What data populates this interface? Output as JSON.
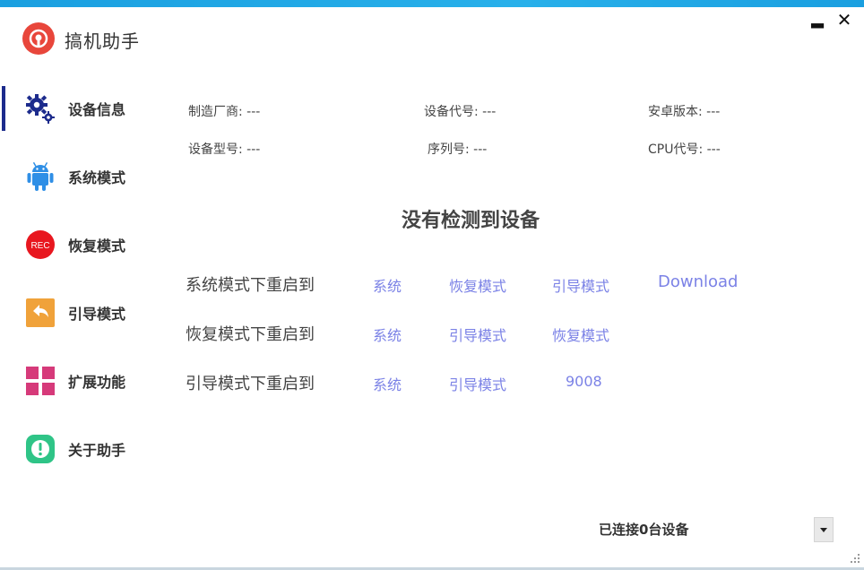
{
  "app": {
    "title": "搞机助手"
  },
  "window_controls": {
    "minimize": "▂",
    "close": "✕"
  },
  "sidebar": {
    "items": [
      {
        "label": "设备信息",
        "icon": "gears-icon",
        "active": true
      },
      {
        "label": "系统模式",
        "icon": "android-icon"
      },
      {
        "label": "恢复模式",
        "icon": "rec-icon",
        "icon_text": "REC"
      },
      {
        "label": "引导模式",
        "icon": "back-arrow-icon"
      },
      {
        "label": "扩展功能",
        "icon": "grid-icon"
      },
      {
        "label": "关于助手",
        "icon": "info-alert-icon"
      }
    ]
  },
  "device_info": {
    "manufacturer": "制造厂商: ---",
    "device_code": "设备代号: ---",
    "android_version": "安卓版本: ---",
    "model": "设备型号: ---",
    "serial": "序列号: ---",
    "cpu_code": "CPU代号: ---"
  },
  "detect_message": "没有检测到设备",
  "reboot_rows": [
    {
      "label": "系统模式下重启到",
      "options": [
        "系统",
        "恢复模式",
        "引导模式",
        "Download"
      ]
    },
    {
      "label": "恢复模式下重启到",
      "options": [
        "系统",
        "引导模式",
        "恢复模式"
      ]
    },
    {
      "label": "引导模式下重启到",
      "options": [
        "系统",
        "引导模式",
        "9008"
      ]
    }
  ],
  "status": {
    "connected_text": "已连接0台设备"
  },
  "colors": {
    "accent": "#1a9fe0",
    "link": "#7b82e6",
    "active_bar": "#1c2b8c",
    "logo": "#e8463b"
  }
}
